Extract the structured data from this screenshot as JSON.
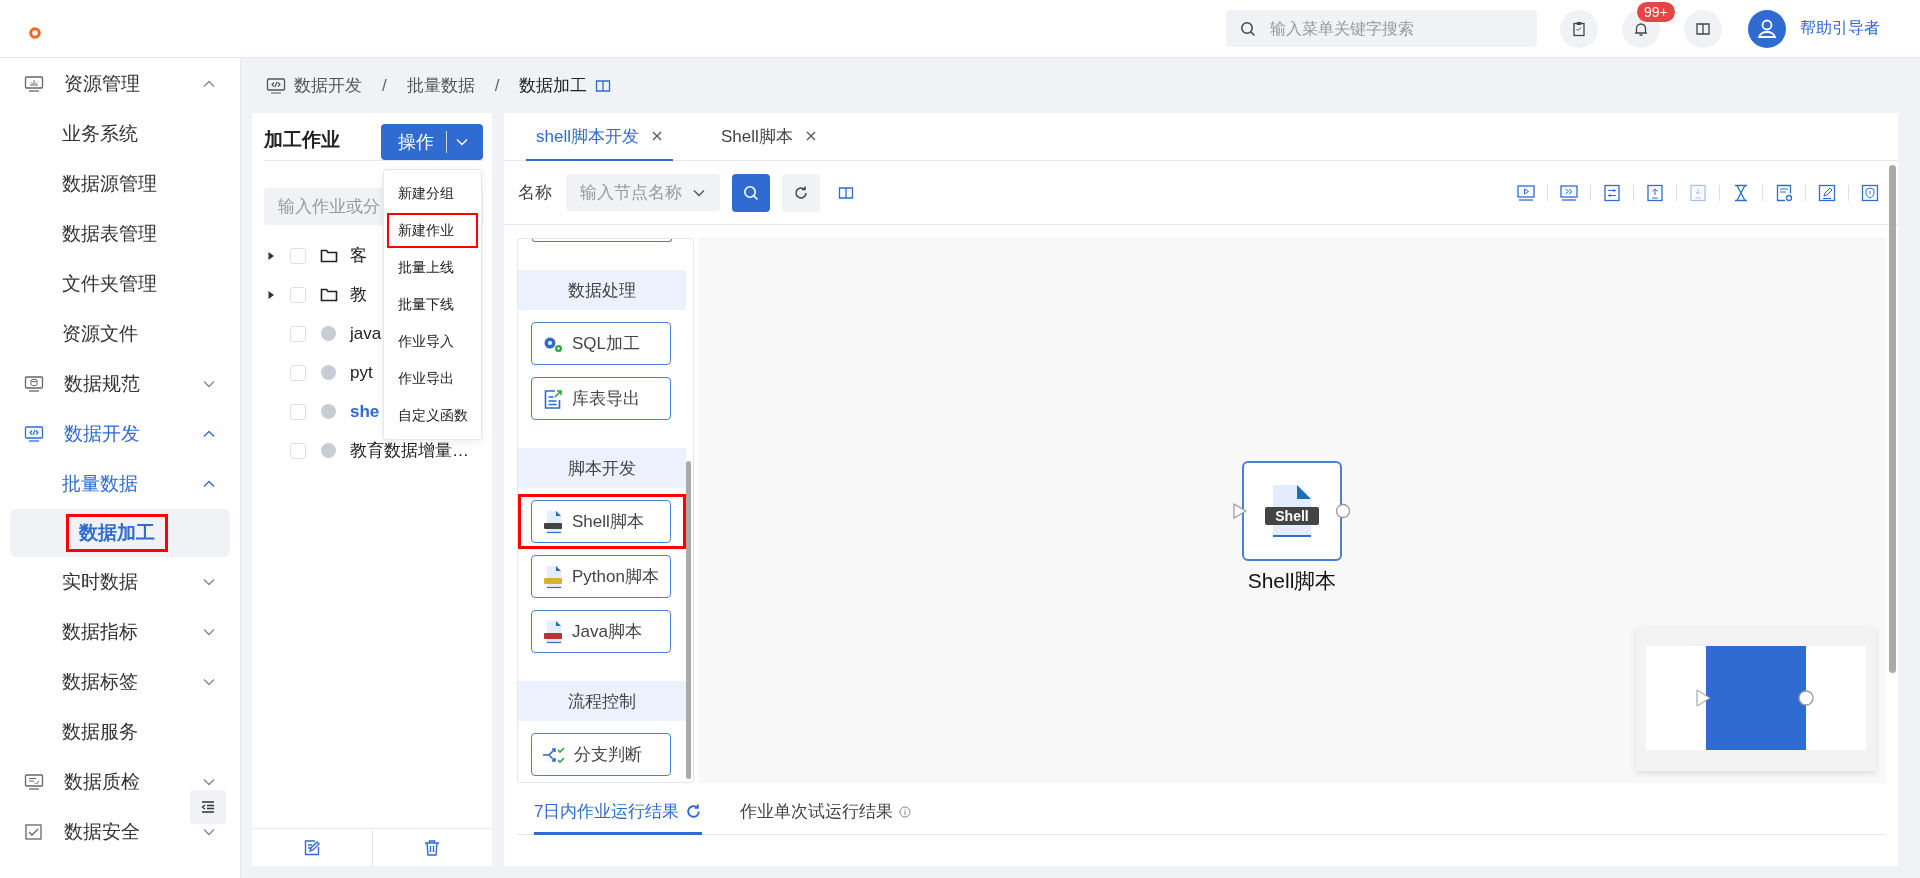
{
  "topbar": {
    "search": {
      "placeholder": "输入菜单关键字搜索"
    },
    "notifications": {
      "badge": "99+"
    },
    "user": {
      "name": "帮助引导者"
    }
  },
  "sidebar": {
    "items": [
      {
        "label": "资源管理",
        "kind": "monitor",
        "expanded": true,
        "active": false,
        "children": [
          {
            "label": "业务系统",
            "selected": false,
            "highlighted": false
          },
          {
            "label": "数据源管理",
            "selected": false,
            "highlighted": false
          },
          {
            "label": "数据表管理",
            "selected": false,
            "highlighted": false
          },
          {
            "label": "文件夹管理",
            "selected": false,
            "highlighted": false
          },
          {
            "label": "资源文件",
            "selected": false,
            "highlighted": false
          }
        ]
      },
      {
        "label": "数据规范",
        "kind": "database",
        "expanded": false,
        "active": false
      },
      {
        "label": "数据开发",
        "kind": "code",
        "expanded": true,
        "active": true,
        "children": [
          {
            "label": "批量数据",
            "expanded": true,
            "active": true,
            "children": [
              {
                "label": "数据加工",
                "selected": true,
                "highlighted": true
              }
            ]
          },
          {
            "label": "实时数据",
            "expanded": false,
            "active": false
          },
          {
            "label": "数据指标",
            "expanded": false,
            "active": false
          },
          {
            "label": "数据标签",
            "expanded": false,
            "active": false
          },
          {
            "label": "数据服务",
            "selected": false,
            "highlighted": false
          }
        ]
      },
      {
        "label": "数据质检",
        "kind": "report",
        "expanded": false,
        "active": false
      },
      {
        "label": "数据安全",
        "kind": "check",
        "expanded": false,
        "active": false
      }
    ]
  },
  "breadcrumb": {
    "separator": "/",
    "items": [
      {
        "label": "数据开发",
        "current": false
      },
      {
        "label": "批量数据",
        "current": false
      },
      {
        "label": "数据加工",
        "current": true
      }
    ]
  },
  "jobs": {
    "title": "加工作业",
    "action_button": "操作",
    "menu": [
      {
        "label": "新建分组",
        "highlighted": false
      },
      {
        "label": "新建作业",
        "highlighted": true
      },
      {
        "label": "批量上线",
        "highlighted": false
      },
      {
        "label": "批量下线",
        "highlighted": false
      },
      {
        "label": "作业导入",
        "highlighted": false
      },
      {
        "label": "作业导出",
        "highlighted": false
      },
      {
        "label": "自定义函数",
        "highlighted": false
      }
    ],
    "search": {
      "placeholder": "输入作业或分"
    },
    "tree": [
      {
        "kind": "folder",
        "label": "客",
        "expanded": false,
        "checked": false,
        "selected": false
      },
      {
        "kind": "folder",
        "label": "教",
        "expanded": false,
        "checked": false,
        "selected": false
      },
      {
        "kind": "job",
        "label": "java",
        "checked": false,
        "selected": false
      },
      {
        "kind": "job",
        "label": "pyt",
        "checked": false,
        "selected": false
      },
      {
        "kind": "job",
        "label": "she",
        "checked": false,
        "selected": true
      },
      {
        "kind": "job",
        "label": "教育数据增量…",
        "checked": false,
        "selected": false
      }
    ]
  },
  "workspace": {
    "tabs": [
      {
        "label": "shell脚本开发",
        "selected": true
      },
      {
        "label": "Shell脚本",
        "selected": false
      }
    ],
    "filter": {
      "label": "名称",
      "placeholder": "输入节点名称"
    },
    "toolbar": [
      {
        "kind": "play",
        "disabled": false
      },
      {
        "kind": "forward",
        "disabled": false
      },
      {
        "kind": "sliders",
        "disabled": false
      },
      {
        "kind": "upload",
        "disabled": false
      },
      {
        "kind": "download",
        "disabled": true
      },
      {
        "kind": "hourglass",
        "disabled": false
      },
      {
        "kind": "docgear",
        "disabled": false
      },
      {
        "kind": "edit",
        "disabled": false
      },
      {
        "kind": "shield",
        "disabled": false
      }
    ],
    "palette": [
      {
        "title": "数据处理",
        "items": [
          {
            "label": "SQL加工",
            "kind": "gears",
            "highlighted": false
          },
          {
            "label": "库表导出",
            "kind": "export",
            "highlighted": false
          }
        ]
      },
      {
        "title": "脚本开发",
        "items": [
          {
            "label": "Shell脚本",
            "kind": "shell",
            "highlighted": true
          },
          {
            "label": "Python脚本",
            "kind": "python",
            "highlighted": false
          },
          {
            "label": "Java脚本",
            "kind": "java",
            "highlighted": false
          }
        ]
      },
      {
        "title": "流程控制",
        "items": [
          {
            "label": "分支判断",
            "kind": "branch",
            "highlighted": false
          }
        ]
      }
    ],
    "canvas": {
      "nodes": [
        {
          "label": "Shell脚本",
          "badge": "Shell",
          "selected": true
        }
      ]
    },
    "result_tabs": [
      {
        "label": "7日内作业运行结果",
        "kind": "refresh",
        "selected": true
      },
      {
        "label": "作业单次试运行结果",
        "kind": "info",
        "selected": false
      }
    ]
  }
}
